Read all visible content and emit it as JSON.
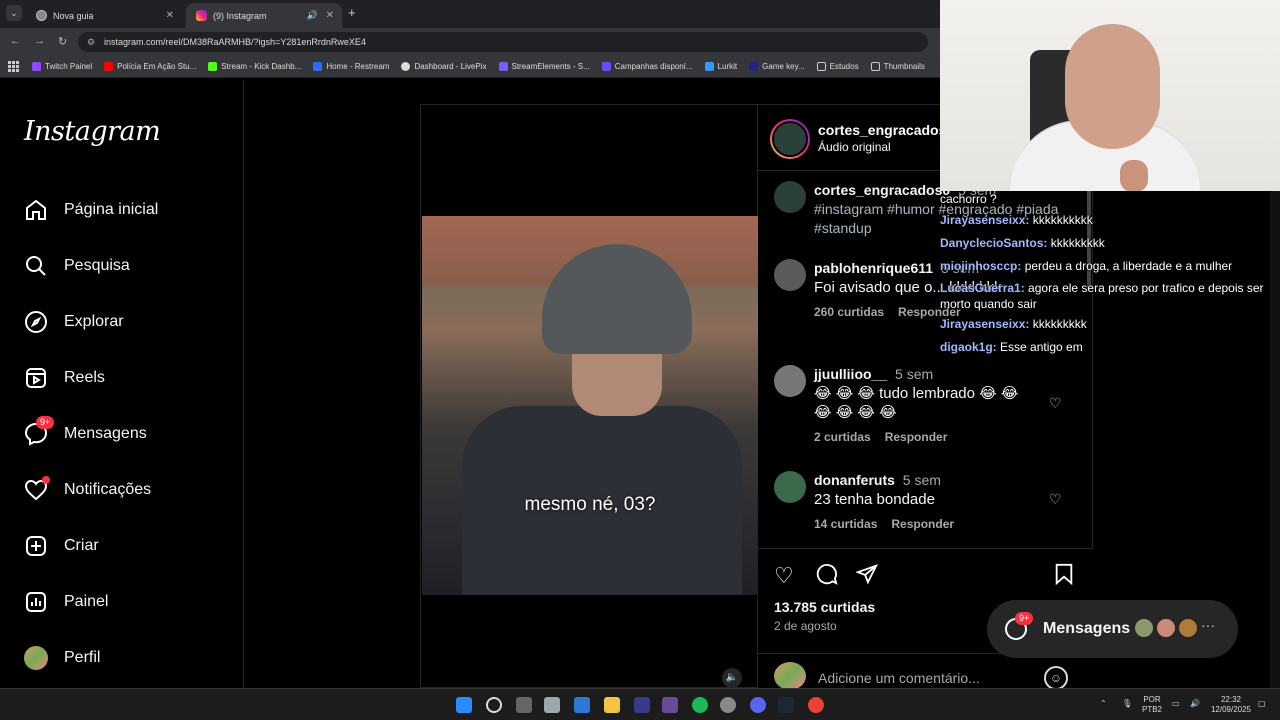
{
  "browser": {
    "tabs": [
      {
        "label": "Nova guia"
      },
      {
        "label": "(9) Instagram"
      }
    ],
    "url": "instagram.com/reel/DM38RaARMHB/?igsh=Y281enRrdnRweXE4",
    "bookmarks": [
      {
        "label": "Twitch Painel",
        "color": "#9146ff"
      },
      {
        "label": "Polícia Em Ação Stu...",
        "color": "#ff0000"
      },
      {
        "label": "Stream - Kick Dashb...",
        "color": "#53fc18"
      },
      {
        "label": "Home - Restream",
        "color": "#2f6bff"
      },
      {
        "label": "Dashboard - LivePix",
        "color": "#dddddd"
      },
      {
        "label": "StreamElements - S...",
        "color": "#7a5cff"
      },
      {
        "label": "Campanhas disponí...",
        "color": "#6a4cff"
      },
      {
        "label": "Lurkit",
        "color": "#3399ff"
      },
      {
        "label": "Game key...",
        "color": "#222288"
      },
      {
        "label": "Estudos",
        "color": "#cccccc"
      },
      {
        "label": "Thumbnails",
        "color": "#cccccc"
      }
    ]
  },
  "sidebar": {
    "logo": "Instagram",
    "items": [
      {
        "label": "Página inicial",
        "icon": "home-icon"
      },
      {
        "label": "Pesquisa",
        "icon": "search-icon"
      },
      {
        "label": "Explorar",
        "icon": "compass-icon"
      },
      {
        "label": "Reels",
        "icon": "reels-icon"
      },
      {
        "label": "Mensagens",
        "icon": "messenger-icon",
        "badge": "9+"
      },
      {
        "label": "Notificações",
        "icon": "heart-icon"
      },
      {
        "label": "Criar",
        "icon": "plus-square-icon"
      },
      {
        "label": "Painel",
        "icon": "dashboard-icon"
      },
      {
        "label": "Perfil",
        "icon": "avatar-icon"
      }
    ]
  },
  "video": {
    "subtitle": "mesmo né, 03?"
  },
  "post": {
    "username": "cortes_engracados0",
    "audio": "Áudio original",
    "caption_user": "cortes_engracados0",
    "caption_time": "5 sem",
    "caption_tags": "#instagram #humor #engraçado #piada #standup",
    "comments": [
      {
        "user": "pablohenrique611",
        "time": "5 sem",
        "text": "Foi avisado que o... kkkkkkk",
        "likes": "260 curtidas",
        "reply": "Responder"
      },
      {
        "user": "jjuulliioo__",
        "time": "5 sem",
        "text": "😂 😂 😂 tudo lembrado 😂 😂 😂 😂 😂 😂",
        "likes": "2 curtidas",
        "reply": "Responder"
      },
      {
        "user": "donanferuts",
        "time": "5 sem",
        "text": "23 tenha bondade",
        "likes": "14 curtidas",
        "reply": "Responder"
      }
    ],
    "like_count": "13.785 curtidas",
    "date": "2 de agosto",
    "comment_placeholder": "Adicione um comentário..."
  },
  "chat_overlay": [
    {
      "user": "",
      "text": "cachorro ?"
    },
    {
      "user": "Jirayasenseixx:",
      "text": "kkkkkkkkkk"
    },
    {
      "user": "DanyclecioSantos:",
      "text": "kkkkkkkkk"
    },
    {
      "user": "miojinhosccp:",
      "text": "perdeu a droga, a liberdade e a mulher"
    },
    {
      "user": "LucasGuerra1:",
      "text": "agora ele sera preso por trafico e depois ser morto quando sair"
    },
    {
      "user": "Jirayasenseixx:",
      "text": "kkkkkkkkk"
    },
    {
      "user": "digaok1g:",
      "text": "Esse antigo em"
    }
  ],
  "messages_bubble": {
    "label": "Mensagens",
    "badge": "9+"
  },
  "taskbar": {
    "lang": "POR",
    "layout": "PTB2",
    "time": "22:32",
    "date": "12/09/2025"
  }
}
